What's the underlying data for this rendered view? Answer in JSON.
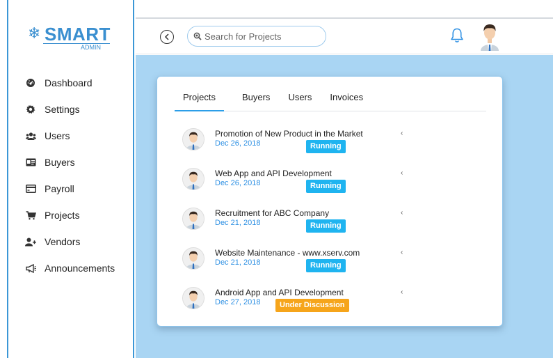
{
  "brand": {
    "name": "SMART",
    "sub": "ADMIN",
    "color": "#3a8fd0",
    "icon": "snowflake-icon"
  },
  "sidebar": {
    "items": [
      {
        "label": "Dashboard",
        "icon": "dashboard-icon"
      },
      {
        "label": "Settings",
        "icon": "gear-icon"
      },
      {
        "label": "Users",
        "icon": "users-icon"
      },
      {
        "label": "Buyers",
        "icon": "id-card-icon"
      },
      {
        "label": "Payroll",
        "icon": "credit-card-icon"
      },
      {
        "label": "Projects",
        "icon": "cart-icon"
      },
      {
        "label": "Vendors",
        "icon": "user-plus-icon"
      },
      {
        "label": "Announcements",
        "icon": "megaphone-icon"
      }
    ]
  },
  "header": {
    "search_placeholder": "Search for Projects"
  },
  "tabs": [
    {
      "label": "Projects",
      "active": true
    },
    {
      "label": "Buyers",
      "active": false
    },
    {
      "label": "Users",
      "active": false
    },
    {
      "label": "Invoices",
      "active": false
    }
  ],
  "projects": [
    {
      "title": "Promotion of New Product in the Market",
      "date": "Dec 26, 2018",
      "status": "Running"
    },
    {
      "title": "Web App and API Development",
      "date": "Dec 26, 2018",
      "status": "Running"
    },
    {
      "title": "Recruitment for ABC Company",
      "date": "Dec 21, 2018",
      "status": "Running"
    },
    {
      "title": "Website Maintenance - www.xserv.com",
      "date": "Dec 21, 2018",
      "status": "Running"
    },
    {
      "title": "Android App and API Development",
      "date": "Dec 27, 2018",
      "status": "Under Discussion"
    }
  ],
  "colors": {
    "accent": "#2c9ee8",
    "running": "#1fb4f0",
    "discussion": "#f6a51b",
    "content_bg": "#a9d5f3"
  }
}
